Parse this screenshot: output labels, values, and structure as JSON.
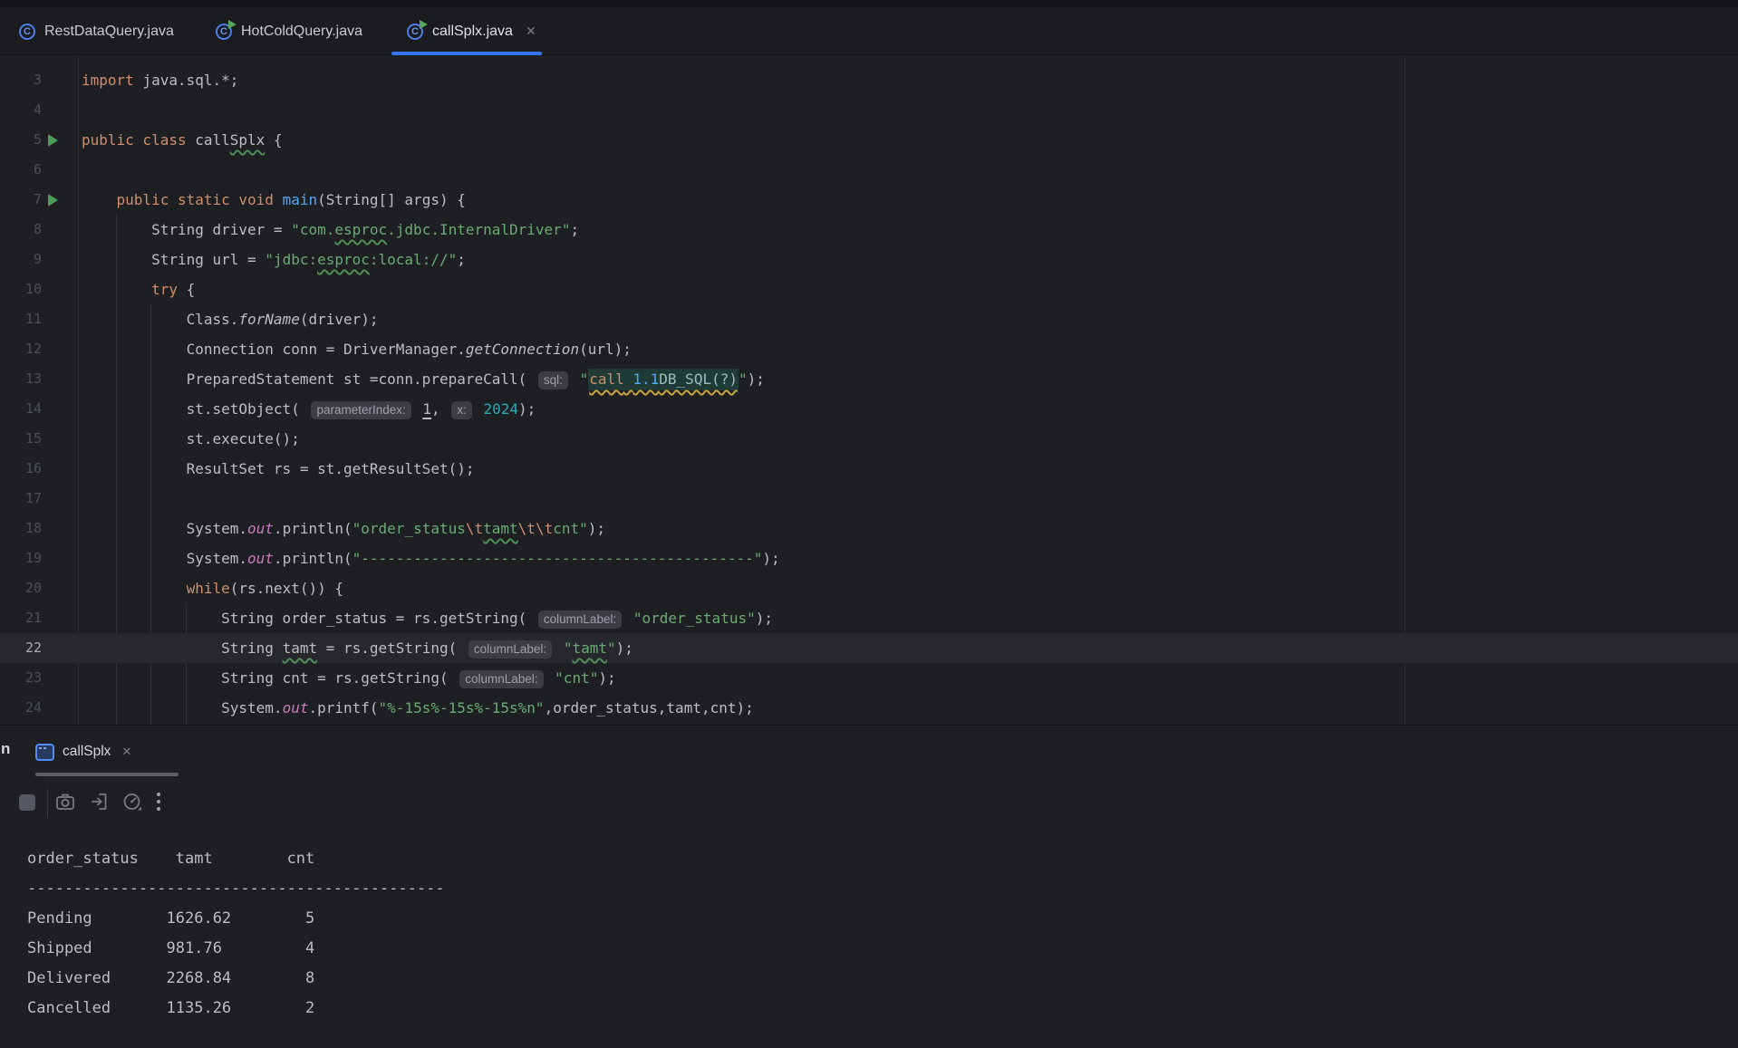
{
  "colors": {
    "accent": "#3574F0",
    "editor_bg": "#1E1F22",
    "keyword": "#CF8E6D",
    "string": "#6AAB73",
    "number": "#2AACB8",
    "injected_bg": "#1E3B35",
    "run_icon": "#4C9B57"
  },
  "editor_tabs": [
    {
      "label": "RestDataQuery.java",
      "icon": "java-class-icon",
      "run_overlay": false,
      "active": false,
      "closable": false
    },
    {
      "label": "HotColdQuery.java",
      "icon": "java-class-runnable-icon",
      "run_overlay": true,
      "active": false,
      "closable": false
    },
    {
      "label": "callSplx.java",
      "icon": "java-class-runnable-icon",
      "run_overlay": true,
      "active": true,
      "closable": true,
      "close_glyph": "✕"
    }
  ],
  "editor": {
    "first_line_number": 3,
    "lines": [
      {
        "n": 3,
        "run": false,
        "active": false,
        "t": [
          [
            "kw",
            "import"
          ],
          [
            "d",
            " java.sql.*;"
          ]
        ]
      },
      {
        "n": 4,
        "run": false,
        "active": false,
        "t": []
      },
      {
        "n": 5,
        "run": true,
        "active": false,
        "t": [
          [
            "kw",
            "public class"
          ],
          [
            "d",
            " call"
          ],
          [
            "dw",
            "Splx"
          ],
          [
            "d",
            " {"
          ]
        ]
      },
      {
        "n": 6,
        "run": false,
        "active": false,
        "t": []
      },
      {
        "n": 7,
        "run": true,
        "active": false,
        "t": [
          [
            "d",
            "    "
          ],
          [
            "kw",
            "public static void"
          ],
          [
            "d",
            " "
          ],
          [
            "mb",
            "main"
          ],
          [
            "d",
            "(String[] args) {"
          ]
        ]
      },
      {
        "n": 8,
        "run": false,
        "active": false,
        "t": [
          [
            "d",
            "        String driver = "
          ],
          [
            "str",
            "\"com."
          ],
          [
            "strw",
            "esproc"
          ],
          [
            "str",
            ".jdbc.InternalDriver\""
          ],
          [
            "d",
            ";"
          ]
        ]
      },
      {
        "n": 9,
        "run": false,
        "active": false,
        "t": [
          [
            "d",
            "        String url = "
          ],
          [
            "str",
            "\"jdbc:"
          ],
          [
            "strw",
            "esproc"
          ],
          [
            "str",
            ":local://\""
          ],
          [
            "d",
            ";"
          ]
        ]
      },
      {
        "n": 10,
        "run": false,
        "active": false,
        "t": [
          [
            "d",
            "        "
          ],
          [
            "kw",
            "try"
          ],
          [
            "d",
            " {"
          ]
        ]
      },
      {
        "n": 11,
        "run": false,
        "active": false,
        "t": [
          [
            "d",
            "            Class."
          ],
          [
            "sm",
            "forName"
          ],
          [
            "d",
            "(driver);"
          ]
        ]
      },
      {
        "n": 12,
        "run": false,
        "active": false,
        "t": [
          [
            "d",
            "            Connection conn = DriverManager."
          ],
          [
            "sm",
            "getConnection"
          ],
          [
            "d",
            "(url);"
          ]
        ]
      },
      {
        "n": 13,
        "run": false,
        "active": false,
        "t": [
          [
            "d",
            "            PreparedStatement st =conn.prepareCall( "
          ],
          [
            "hint",
            "sql:"
          ],
          [
            "d",
            " "
          ],
          [
            "str",
            "\""
          ],
          [
            "inj",
            [
              [
                "kw",
                "call"
              ],
              [
                "injd",
                " "
              ],
              [
                "injnum",
                "1.1"
              ],
              [
                "injid",
                "DB_SQL(?)"
              ]
            ]
          ],
          [
            "str",
            "\""
          ],
          [
            "d",
            ");"
          ]
        ]
      },
      {
        "n": 14,
        "run": false,
        "active": false,
        "t": [
          [
            "d",
            "            st.setObject( "
          ],
          [
            "hint",
            "parameterIndex:"
          ],
          [
            "d",
            " "
          ],
          [
            "numl",
            "1"
          ],
          [
            "d",
            ", "
          ],
          [
            "hint",
            "x:"
          ],
          [
            "d",
            " "
          ],
          [
            "num",
            "2024"
          ],
          [
            "d",
            ");"
          ]
        ]
      },
      {
        "n": 15,
        "run": false,
        "active": false,
        "t": [
          [
            "d",
            "            st.execute();"
          ]
        ]
      },
      {
        "n": 16,
        "run": false,
        "active": false,
        "t": [
          [
            "d",
            "            ResultSet rs = st.getResultSet();"
          ]
        ]
      },
      {
        "n": 17,
        "run": false,
        "active": false,
        "t": []
      },
      {
        "n": 18,
        "run": false,
        "active": false,
        "t": [
          [
            "d",
            "            System."
          ],
          [
            "fld",
            "out"
          ],
          [
            "d",
            ".println("
          ],
          [
            "str",
            "\"order_status"
          ],
          [
            "esc",
            "\\t"
          ],
          [
            "strw",
            "tamt"
          ],
          [
            "esc",
            "\\t\\t"
          ],
          [
            "str",
            "cnt\""
          ],
          [
            "d",
            ");"
          ]
        ]
      },
      {
        "n": 19,
        "run": false,
        "active": false,
        "t": [
          [
            "d",
            "            System."
          ],
          [
            "fld",
            "out"
          ],
          [
            "d",
            ".println("
          ],
          [
            "str",
            "\"---------------------------------------------\""
          ],
          [
            "d",
            ");"
          ]
        ]
      },
      {
        "n": 20,
        "run": false,
        "active": false,
        "t": [
          [
            "d",
            "            "
          ],
          [
            "kw",
            "while"
          ],
          [
            "d",
            "(rs.next()) {"
          ]
        ]
      },
      {
        "n": 21,
        "run": false,
        "active": false,
        "t": [
          [
            "d",
            "                String order_status = rs.getString( "
          ],
          [
            "hint",
            "columnLabel:"
          ],
          [
            "d",
            " "
          ],
          [
            "str",
            "\"order_status\""
          ],
          [
            "d",
            ");"
          ]
        ]
      },
      {
        "n": 22,
        "run": false,
        "active": true,
        "t": [
          [
            "d",
            "                String "
          ],
          [
            "dw",
            "tamt"
          ],
          [
            "d",
            " = rs.getString( "
          ],
          [
            "hint",
            "columnLabel:"
          ],
          [
            "d",
            " "
          ],
          [
            "str",
            "\""
          ],
          [
            "strw",
            "tamt"
          ],
          [
            "str",
            "\""
          ],
          [
            "d",
            ");"
          ]
        ]
      },
      {
        "n": 23,
        "run": false,
        "active": false,
        "t": [
          [
            "d",
            "                String cnt = rs.getString( "
          ],
          [
            "hint",
            "columnLabel:"
          ],
          [
            "d",
            " "
          ],
          [
            "str",
            "\"cnt\""
          ],
          [
            "d",
            ");"
          ]
        ]
      },
      {
        "n": 24,
        "run": false,
        "active": false,
        "t": [
          [
            "d",
            "                System."
          ],
          [
            "fld",
            "out"
          ],
          [
            "d",
            ".printf("
          ],
          [
            "str",
            "\"%-15s%-15s%-15s%n\""
          ],
          [
            "d",
            ",order_status,tamt,cnt);"
          ]
        ]
      }
    ]
  },
  "panel": {
    "cut_label": "n",
    "tab": {
      "label": "callSplx",
      "icon": "console-icon",
      "close_glyph": "✕"
    },
    "toolbar_icons": [
      "stop-icon",
      "screenshot-icon",
      "attach-icon",
      "profiler-icon",
      "more-options-icon"
    ]
  },
  "console": {
    "lines": [
      "order_status    tamt        cnt",
      "---------------------------------------------",
      "Pending        1626.62        5",
      "Shipped        981.76         4",
      "Delivered      2268.84        8",
      "Cancelled      1135.26        2"
    ]
  }
}
